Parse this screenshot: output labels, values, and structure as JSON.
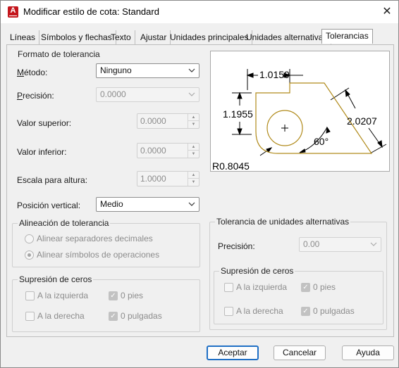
{
  "window": {
    "title": "Modificar estilo de cota: Standard",
    "close_glyph": "✕",
    "app_icon_letter": "A"
  },
  "tabs": [
    {
      "label": "Líneas"
    },
    {
      "label": "Símbolos y flechas"
    },
    {
      "label": "Texto"
    },
    {
      "label": "Ajustar"
    },
    {
      "label": "Unidades principales"
    },
    {
      "label": "Unidades alternativas"
    },
    {
      "label": "Tolerancias",
      "active": true
    }
  ],
  "tolerance_format": {
    "title": "Formato de tolerancia",
    "method_label": "Método:",
    "method_value": "Ninguno",
    "precision_label": "Precisión:",
    "precision_value": "0.0000",
    "upper_label": "Valor superior:",
    "upper_value": "0.0000",
    "lower_label": "Valor inferior:",
    "lower_value": "0.0000",
    "height_label": "Escala para altura:",
    "height_value": "1.0000",
    "vertical_label": "Posición vertical:",
    "vertical_value": "Medio"
  },
  "alignment": {
    "title": "Alineación de tolerancia",
    "opt1": "Alinear separadores decimales",
    "opt2": "Alinear símbolos de operaciones",
    "selected": 2
  },
  "zero_left": {
    "title": "Supresión de ceros",
    "leading": "A la izquierda",
    "trailing": "A la derecha",
    "feet": "0 pies",
    "inches": "0 pulgadas",
    "leading_checked": false,
    "trailing_checked": false,
    "feet_checked": true,
    "inches_checked": true
  },
  "alt_units": {
    "title": "Tolerancia de unidades alternativas",
    "precision_label": "Precisión:",
    "precision_value": "0.00"
  },
  "zero_right": {
    "title": "Supresión de ceros",
    "leading": "A la izquierda",
    "trailing": "A la derecha",
    "feet": "0 pies",
    "inches": "0 pulgadas",
    "leading_checked": false,
    "trailing_checked": false,
    "feet_checked": true,
    "inches_checked": true
  },
  "preview": {
    "dim_top": "1.0159",
    "dim_left": "1.1955",
    "dim_right": "2.0207",
    "angle": "60°",
    "radius": "R0.8045",
    "colors": {
      "shape": "#b08a1a",
      "dim": "#000000"
    }
  },
  "buttons": {
    "ok": "Aceptar",
    "cancel": "Cancelar",
    "help": "Ayuda"
  }
}
